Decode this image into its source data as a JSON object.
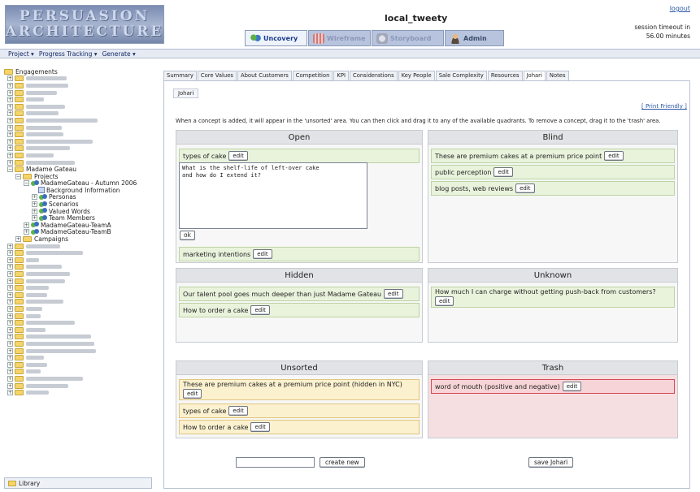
{
  "header": {
    "logo_line1": "PERSUASION",
    "logo_line2": "ARCHITECTURE",
    "app_title": "local_tweety",
    "logout": "logout",
    "session_line1": "session timeout in",
    "session_line2": "56.00 minutes",
    "modes": [
      {
        "label": "Uncovery",
        "icon": "people-icon",
        "color": "#3a78c8"
      },
      {
        "label": "Wireframe",
        "icon": "wireframe-icon",
        "color": "#d17a7a"
      },
      {
        "label": "Storyboard",
        "icon": "storyboard-icon",
        "color": "#a3a8b8"
      },
      {
        "label": "Admin",
        "icon": "admin-person-icon",
        "color": "#c98a3c"
      }
    ]
  },
  "menubar": [
    "Project ▾",
    "Progress Tracking ▾",
    "Generate ▾"
  ],
  "sidebar": {
    "root": "Engagements",
    "madame": "Madame Gateau",
    "projects": "Projects",
    "autumn": "MadameGateau - Autumn 2006",
    "background": "Background Information",
    "personas": "Personas",
    "scenarios": "Scenarios",
    "valued": "Valued Words",
    "team_members": "Team Members",
    "team_a": "MadameGateau-TeamA",
    "team_b": "MadameGateau-TeamB",
    "campaigns": "Campaigns",
    "library": "Library"
  },
  "content_tabs": [
    "Summary",
    "Core Values",
    "About Customers",
    "Competition",
    "KPI",
    "Considerations",
    "Key People",
    "Sale Complexity",
    "Resources",
    "Johari",
    "Notes"
  ],
  "johari": {
    "subtab": "Johari",
    "print_friendly": "[ Print Friendly ]",
    "instructions": "When a concept is added, it will appear in the 'unsorted' area. You can then click and drag it to any of the available quadrants. To remove a concept, drag it to the 'trash' area.",
    "edit_label": "edit",
    "ok_label": "ok",
    "editing_text": "What is the shelf-life of left-over cake\nand how do I extend it?",
    "quadrants": {
      "open": {
        "title": "Open",
        "items": [
          "types of cake",
          "marketing intentions"
        ]
      },
      "blind": {
        "title": "Blind",
        "items": [
          "These are premium cakes at a premium price point",
          "public perception",
          "blog posts, web reviews"
        ]
      },
      "hidden": {
        "title": "Hidden",
        "items": [
          "Our talent pool goes much deeper than just Madame Gateau",
          "How to order a cake"
        ]
      },
      "unknown": {
        "title": "Unknown",
        "items": [
          "How much I can charge without getting push-back from customers?"
        ]
      },
      "unsorted": {
        "title": "Unsorted",
        "items": [
          "These are premium cakes at a premium price point (hidden in NYC)",
          "types of cake",
          "How to order a cake"
        ]
      },
      "trash": {
        "title": "Trash",
        "items": [
          "word of mouth (positive and negative)"
        ]
      }
    },
    "new_concept_placeholder": "",
    "create_new_label": "create new",
    "save_label": "save Johari"
  }
}
